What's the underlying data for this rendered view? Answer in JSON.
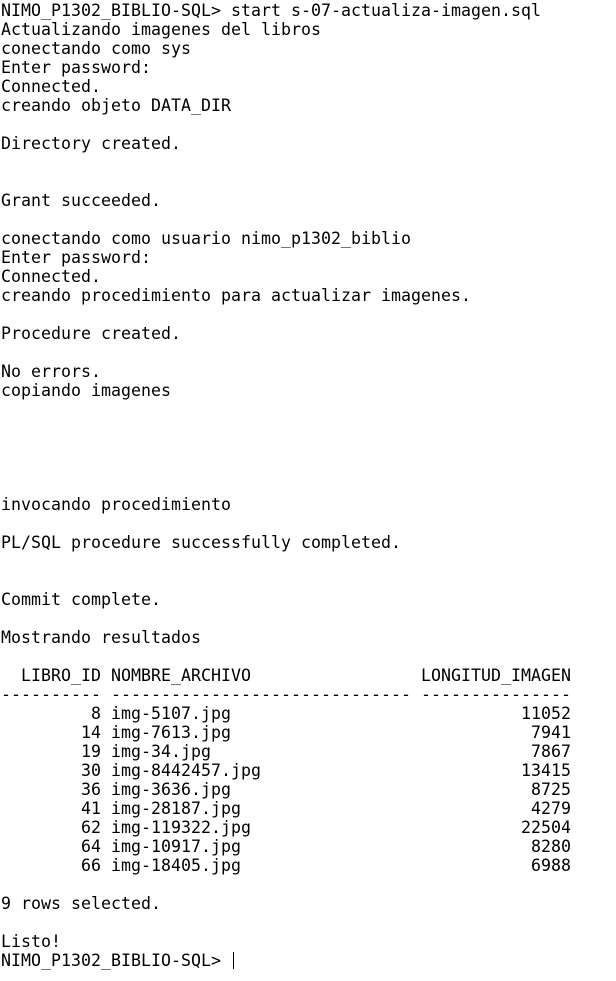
{
  "terminal": {
    "lines": [
      "NIMO_P1302_BIBLIO-SQL> start s-07-actualiza-imagen.sql",
      "Actualizando imagenes del libros",
      "conectando como sys",
      "Enter password:",
      "Connected.",
      "creando objeto DATA_DIR",
      "",
      "Directory created.",
      "",
      "",
      "Grant succeeded.",
      "",
      "conectando como usuario nimo_p1302_biblio",
      "Enter password:",
      "Connected.",
      "creando procedimiento para actualizar imagenes.",
      "",
      "Procedure created.",
      "",
      "No errors.",
      "copiando imagenes",
      "",
      "",
      "",
      "",
      "",
      "invocando procedimiento",
      "",
      "PL/SQL procedure successfully completed.",
      "",
      "",
      "Commit complete.",
      "",
      "Mostrando resultados",
      "",
      "  LIBRO_ID NOMBRE_ARCHIVO                 LONGITUD_IMAGEN",
      "---------- ------------------------------ ---------------",
      "         8 img-5107.jpg                             11052",
      "        14 img-7613.jpg                              7941",
      "        19 img-34.jpg                                7867",
      "        30 img-8442457.jpg                          13415",
      "        36 img-3636.jpg                              8725",
      "        41 img-28187.jpg                             4279",
      "        62 img-119322.jpg                           22504",
      "        64 img-10917.jpg                             8280",
      "        66 img-18405.jpg                             6988",
      "",
      "9 rows selected.",
      "",
      "Listo!",
      "NIMO_P1302_BIBLIO-SQL> "
    ]
  }
}
